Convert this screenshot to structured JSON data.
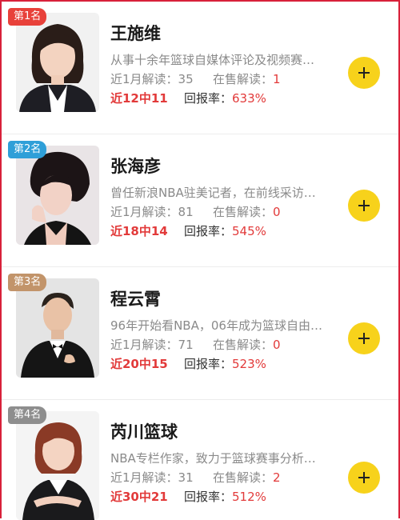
{
  "experts": [
    {
      "rank": "第1名",
      "badge_color": "#e8413a",
      "name": "王施维",
      "description": "从事十余年篮球自媒体评论及视频赛…",
      "monthly_label": "近1月解读：",
      "monthly_value": "35",
      "on_sale_label": "在售解读：",
      "on_sale_value": "1",
      "streak": "近12中11",
      "roi_label": "回报率：",
      "roi_value": "633%"
    },
    {
      "rank": "第2名",
      "badge_color": "#2f9fd8",
      "name": "张海彦",
      "description": "曾任新浪NBA驻美记者，在前线采访…",
      "monthly_label": "近1月解读：",
      "monthly_value": "81",
      "on_sale_label": "在售解读：",
      "on_sale_value": "0",
      "streak": "近18中14",
      "roi_label": "回报率：",
      "roi_value": "545%"
    },
    {
      "rank": "第3名",
      "badge_color": "#c2946a",
      "name": "程云霄",
      "description": "96年开始看NBA，06年成为篮球自由…",
      "monthly_label": "近1月解读：",
      "monthly_value": "71",
      "on_sale_label": "在售解读：",
      "on_sale_value": "0",
      "streak": "近20中15",
      "roi_label": "回报率：",
      "roi_value": "523%"
    },
    {
      "rank": "第4名",
      "badge_color": "#8e8e8e",
      "name": "芮川篮球",
      "description": "NBA专栏作家，致力于篮球赛事分析…",
      "monthly_label": "近1月解读：",
      "monthly_value": "31",
      "on_sale_label": "在售解读：",
      "on_sale_value": "2",
      "streak": "近30中21",
      "roi_label": "回报率：",
      "roi_value": "512%"
    }
  ],
  "icons": {
    "follow": "plus-icon"
  },
  "colors": {
    "accent_red": "#e23a3a",
    "follow_yellow": "#f7d21b",
    "frame_red": "#d8213a"
  }
}
